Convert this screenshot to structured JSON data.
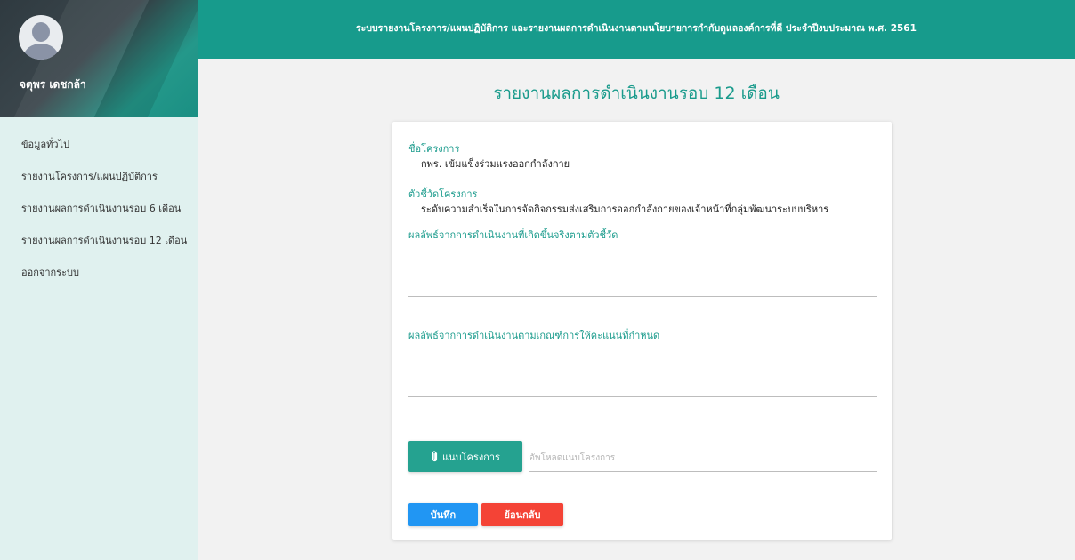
{
  "header": {
    "title": "ระบบรายงานโครงการ/แผนปฏิบัติการ และรายงานผลการดำเนินงานตามนโยบายการกำกับดูแลองค์การที่ดี ประจำปีงบประมาณ พ.ศ. 2561"
  },
  "profile": {
    "name": "จตุพร เดชกล้า",
    "avatar_icon": "user-avatar-icon"
  },
  "sidebar": {
    "items": [
      {
        "label": "ข้อมูลทั่วไป"
      },
      {
        "label": "รายงานโครงการ/แผนปฏิบัติการ"
      },
      {
        "label": "รายงานผลการดำเนินงานรอบ 6 เดือน"
      },
      {
        "label": "รายงานผลการดำเนินงานรอบ 12 เดือน"
      },
      {
        "label": "ออกจากระบบ"
      }
    ]
  },
  "main": {
    "page_title": "รายงานผลการดำเนินงานรอบ 12 เดือน",
    "project_label": "ชื่อโครงการ",
    "project_value": "กพร. เข้มแข็งร่วมแรงออกกำลังกาย",
    "indicator_label": "ตัวชี้วัดโครงการ",
    "indicator_value": "ระดับความสำเร็จในการจัดกิจกรรมส่งเสริมการออกกำลังกายของเจ้าหน้าที่กลุ่มพัฒนาระบบบริหาร",
    "actual_result_label": "ผลลัพธ์จากการดำเนินงานที่เกิดขึ้นจริงตามตัวชี้วัด",
    "actual_result_value": "",
    "criteria_result_label": "ผลลัพธ์จากการดำเนินงานตามเกณฑ์การให้คะแนนที่กำหนด",
    "criteria_result_value": "",
    "attach_button_label": "แนบโครงการ",
    "attach_icon": "paperclip-icon",
    "upload_placeholder": "อัพโหลดแนบโครงการ",
    "save_button_label": "บันทึก",
    "back_button_label": "ย้อนกลับ"
  },
  "colors": {
    "accent": "#179b8c",
    "sidebar_bg": "#e0f1ef",
    "save": "#2196f3",
    "back": "#f44336"
  }
}
